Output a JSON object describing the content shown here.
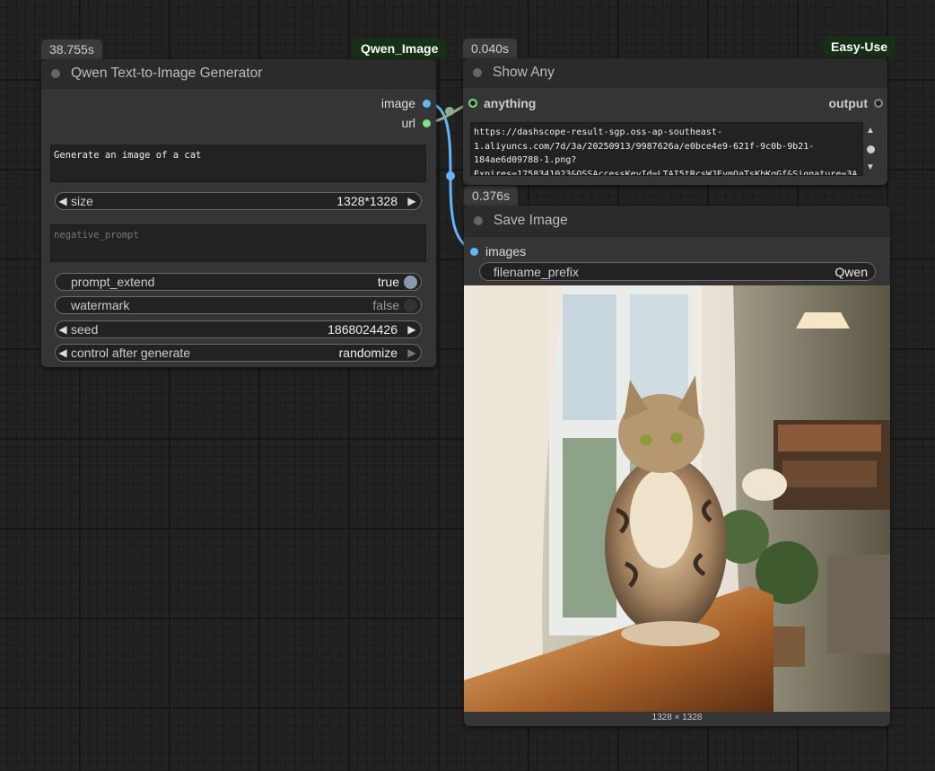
{
  "qwen_node": {
    "time_badge": "38.755s",
    "tag": "Qwen_Image",
    "title": "Qwen Text-to-Image Generator",
    "outputs": [
      "image",
      "url"
    ],
    "prompt": "Generate an image of a cat",
    "size_label": "size",
    "size_value": "1328*1328",
    "negative_prompt_placeholder": "negative_prompt",
    "prompt_extend_label": "prompt_extend",
    "prompt_extend_value": "true",
    "watermark_label": "watermark",
    "watermark_value": "false",
    "seed_label": "seed",
    "seed_value": "1868024426",
    "control_label": "control after generate",
    "control_value": "randomize"
  },
  "show_any_node": {
    "time_badge": "0.040s",
    "tag": "Easy-Use",
    "title": "Show Any",
    "input": "anything",
    "output": "output",
    "text_lines": [
      "https://dashscope-result-sgp.oss-ap-southeast-",
      "1.aliyuncs.com/7d/3a/20250913/9987626a/e0bce4e9-621f-9c0b-9b21-",
      "184ae6d09788-1.png?",
      "Expires=1758341023&OSSAccessKeyId=LTAI5tRcsWJEymQaTsKbKqGf&Signature=3A"
    ]
  },
  "save_node": {
    "time_badge": "0.376s",
    "title": "Save Image",
    "input": "images",
    "filename_label": "filename_prefix",
    "filename_value": "Qwen",
    "image_caption": "1328 × 1328"
  },
  "colors": {
    "image_link": "#64b5f6",
    "url_link": "#8fae8f",
    "tag_bg": "#153015"
  },
  "icons": [
    "left-arrow-icon",
    "right-arrow-icon",
    "toggle-icon",
    "scroll-up-icon",
    "scroll-down-icon"
  ]
}
